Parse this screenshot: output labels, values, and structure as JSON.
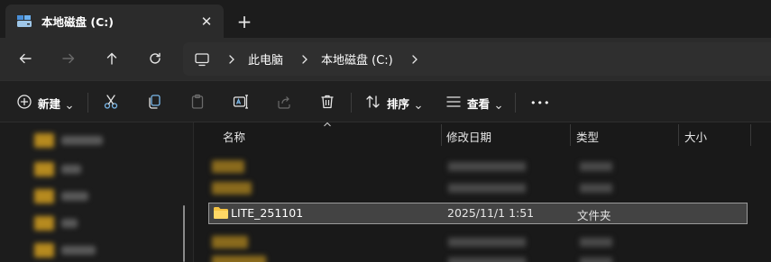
{
  "window": {
    "tab_title": "本地磁盘 (C:)",
    "close_glyph": "✕",
    "new_tab_glyph": "+"
  },
  "address": {
    "crumbs": [
      "此电脑",
      "本地磁盘 (C:)"
    ]
  },
  "toolbar": {
    "new_label": "新建",
    "sort_label": "排序",
    "view_label": "查看",
    "more_glyph": "•••"
  },
  "columns": {
    "name": "名称",
    "modified": "修改日期",
    "type": "类型",
    "size": "大小"
  },
  "files": [
    {
      "name": "LITE_251101",
      "modified": "2025/11/1 1:51",
      "type": "文件夹",
      "selected": true
    }
  ],
  "colors": {
    "accent_folder": "#f5c342",
    "selection_bg": "#434343",
    "selection_border": "#9a9a9a",
    "window_bg": "#1c1c1c"
  },
  "icons": [
    "drive-icon",
    "close-icon",
    "plus-icon",
    "back-icon",
    "forward-icon",
    "up-icon",
    "refresh-icon",
    "computer-icon",
    "chevron-right-icon",
    "new-icon",
    "cut-icon",
    "copy-icon",
    "paste-icon",
    "rename-icon",
    "share-icon",
    "delete-icon",
    "sort-icon",
    "view-icon",
    "more-icon",
    "folder-icon"
  ]
}
